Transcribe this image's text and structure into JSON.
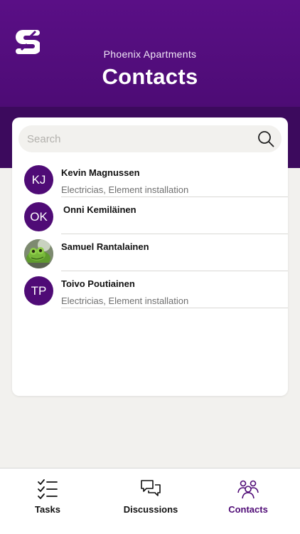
{
  "header": {
    "logo_icon": "app-logo-icon",
    "project_name": "Phoenix Apartments",
    "title": "Contacts"
  },
  "search": {
    "placeholder": "Search",
    "value": "",
    "icon": "search-icon"
  },
  "contacts": [
    {
      "initials": "KJ",
      "name": "Kevin Magnussen",
      "subtitle": "Electricias, Element installation",
      "avatar": "initials"
    },
    {
      "initials": "OK",
      "name": "Onni Kemiläinen",
      "subtitle": "",
      "avatar": "initials"
    },
    {
      "initials": "",
      "name": "Samuel Rantalainen",
      "subtitle": "",
      "avatar": "photo-frog"
    },
    {
      "initials": "TP",
      "name": "Toivo Poutiainen",
      "subtitle": "Electricias, Element installation",
      "avatar": "initials"
    }
  ],
  "tabbar": {
    "tabs": [
      {
        "label": "Tasks",
        "icon": "checklist-icon",
        "active": false
      },
      {
        "label": "Discussions",
        "icon": "chat-bubbles-icon",
        "active": false
      },
      {
        "label": "Contacts",
        "icon": "people-icon",
        "active": true
      }
    ]
  },
  "colors": {
    "brand_purple": "#4f0b76",
    "header_top": "#5a0f86",
    "background": "#f2f1ee"
  }
}
